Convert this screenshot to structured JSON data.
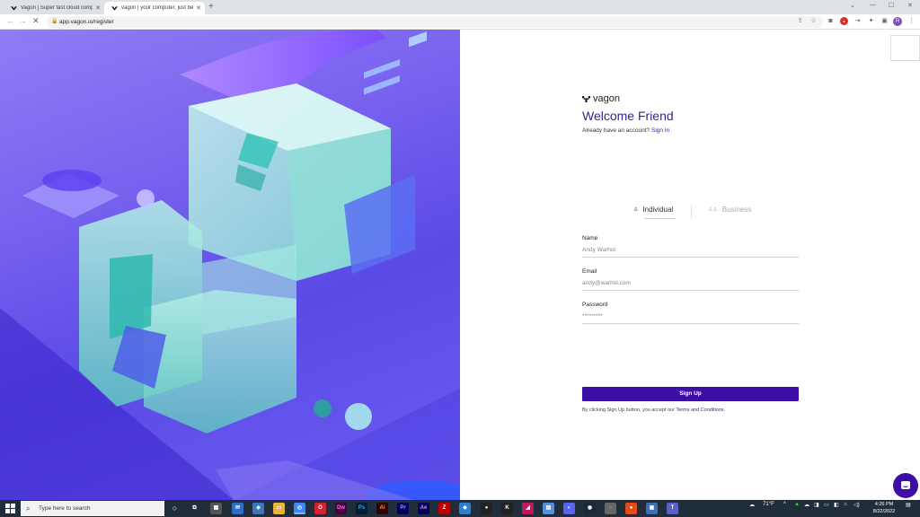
{
  "browser": {
    "tabs": [
      {
        "title": "Vagon | Super fast cloud compu..."
      },
      {
        "title": "vagon | your computer, just bett..."
      }
    ],
    "url": "app.vagon.io/register"
  },
  "page": {
    "brand": "vagon",
    "heading": "Welcome Friend",
    "already_text": "Already have an account?",
    "sign_in_link": "Sign In",
    "account_tabs": {
      "individual": "Individual",
      "business": "Business"
    },
    "fields": {
      "name": {
        "label": "Name",
        "placeholder": "Andy Warhol"
      },
      "email": {
        "label": "Email",
        "placeholder": "andy@warhol.com"
      },
      "password": {
        "label": "Password",
        "placeholder": "*********"
      }
    },
    "signup_button": "Sign Up",
    "terms_prefix": "By clicking Sign Up button, you accept our",
    "terms_link": "Terms and Conditions."
  },
  "taskbar": {
    "search_placeholder": "Type here to search",
    "weather": "71°F",
    "time": "4:26 PM",
    "date": "8/22/2022"
  },
  "colors": {
    "accent": "#3d0ea3",
    "heading": "#3b1d8f",
    "hero": "#7a63ef"
  }
}
